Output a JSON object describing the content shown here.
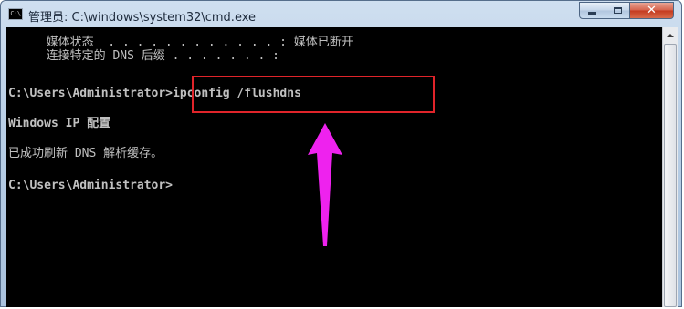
{
  "window": {
    "title": "管理员: C:\\windows\\system32\\cmd.exe",
    "icon_label": "C:\\"
  },
  "console": {
    "lines": [
      "  媒体状态  . . . . . . . . . . . . : 媒体已断开",
      "  连接特定的 DNS 后缀 . . . . . . . :",
      "C:\\Users\\Administrator>ipconfig /flushdns",
      "Windows IP 配置",
      "已成功刷新 DNS 解析缓存。",
      "C:\\Users\\Administrator>"
    ]
  },
  "annotation": {
    "box_color": "#e0242a",
    "arrow_color": "#ee22ee"
  },
  "colors": {
    "console_bg": "#000000",
    "console_text": "#c0c0c0",
    "close_button": "#c43a1f"
  },
  "icons": [
    "cmd-window-icon",
    "minimize-icon",
    "maximize-icon",
    "close-icon",
    "scroll-up-arrow-icon"
  ]
}
